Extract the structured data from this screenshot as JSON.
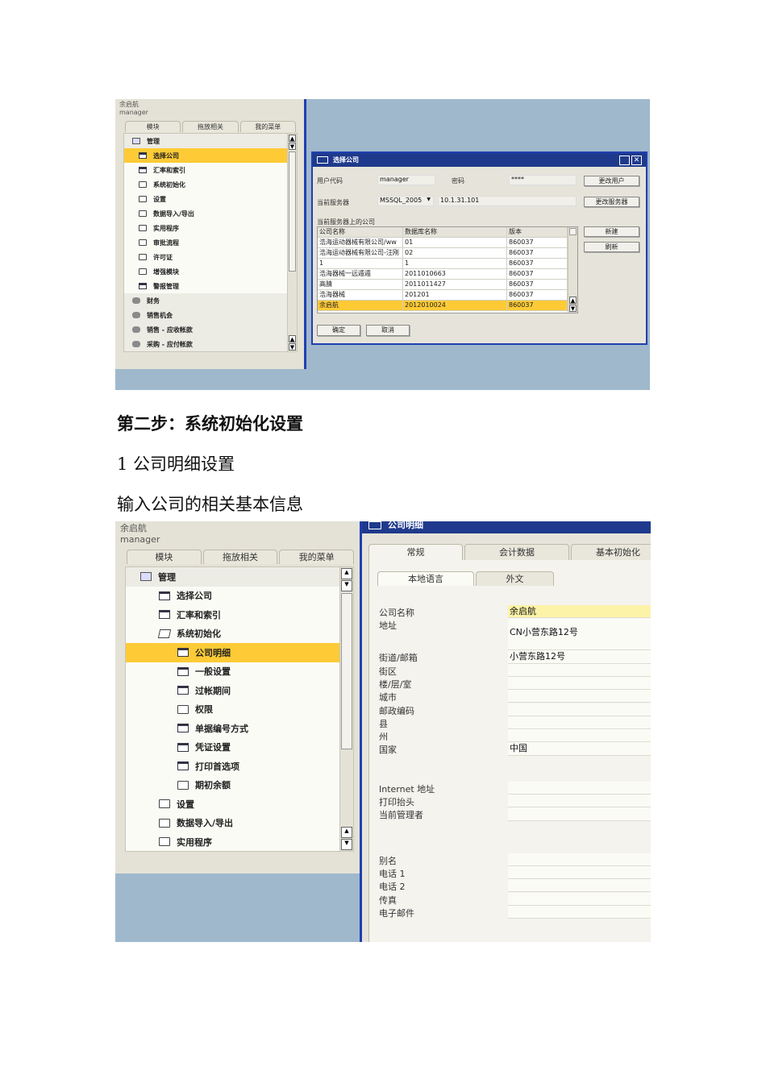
{
  "shot1": {
    "user": {
      "name": "余启航",
      "login": "manager"
    },
    "tabs": [
      "模块",
      "拖放相关",
      "我的菜单"
    ],
    "tree": [
      {
        "label": "管理",
        "icon": "module-icon",
        "kind": "head"
      },
      {
        "label": "选择公司",
        "icon": "form-icon",
        "kind": "sel"
      },
      {
        "label": "汇率和索引",
        "icon": "form-icon"
      },
      {
        "label": "系统初始化",
        "icon": "folder-icon"
      },
      {
        "label": "设置",
        "icon": "folder-icon"
      },
      {
        "label": "数据导入/导出",
        "icon": "folder-icon"
      },
      {
        "label": "实用程序",
        "icon": "folder-icon"
      },
      {
        "label": "审批流程",
        "icon": "folder-icon"
      },
      {
        "label": "许可证",
        "icon": "folder-icon"
      },
      {
        "label": "增强模块",
        "icon": "folder-icon"
      },
      {
        "label": "警报管理",
        "icon": "form-icon"
      },
      {
        "label": "财务",
        "icon": "finance-icon",
        "kind": "head"
      },
      {
        "label": "销售机会",
        "icon": "opportunity-icon",
        "kind": "head"
      },
      {
        "label": "销售 - 应收帐款",
        "icon": "sales-icon",
        "kind": "head"
      },
      {
        "label": "采购 - 应付帐款",
        "icon": "purchase-icon",
        "kind": "head"
      }
    ],
    "dialog": {
      "title": "选择公司",
      "user_code_label": "用户代码",
      "user_code": "manager",
      "password_label": "密码",
      "password": "****",
      "change_user": "更改用户",
      "server_label": "当前服务器",
      "server_type": "MSSQL_2005",
      "server_ip": "10.1.31.101",
      "change_server": "更改服务器",
      "list_label": "当前服务器上的公司",
      "new": "新建",
      "refresh": "刷新",
      "ok": "确定",
      "cancel": "取消",
      "columns": [
        "公司名称",
        "数据库名称",
        "版本"
      ],
      "rows": [
        [
          "浩海运动器械有限公司/ww",
          "01",
          "860037"
        ],
        [
          "浩海运动器械有限公司-汪刚",
          "02",
          "860037"
        ],
        [
          "1",
          "1",
          "860037"
        ],
        [
          "浩海器械一远遁遁",
          "2011010663",
          "860037"
        ],
        [
          "高腈",
          "2011011427",
          "860037"
        ],
        [
          "浩海器械",
          "201201",
          "860037"
        ],
        [
          "余启航",
          "2012010024",
          "860037"
        ]
      ]
    }
  },
  "doc": {
    "heading": "第二步：系统初始化设置",
    "sub": "1 公司明细设置",
    "para": "输入公司的相关基本信息"
  },
  "shot2": {
    "user": {
      "name": "余启航",
      "login": "manager"
    },
    "tabs": [
      "模块",
      "拖放相关",
      "我的菜单"
    ],
    "tree": [
      {
        "label": "管理",
        "icon": "module-icon",
        "kind": "head",
        "indent": 0
      },
      {
        "label": "选择公司",
        "icon": "form-icon",
        "indent": 1
      },
      {
        "label": "汇率和索引",
        "icon": "form-icon",
        "indent": 1
      },
      {
        "label": "系统初始化",
        "icon": "folder-open-icon",
        "indent": 1
      },
      {
        "label": "公司明细",
        "icon": "form-icon",
        "indent": 2,
        "kind": "sel"
      },
      {
        "label": "一般设置",
        "icon": "form-icon",
        "indent": 2
      },
      {
        "label": "过帐期间",
        "icon": "form-icon",
        "indent": 2
      },
      {
        "label": "权限",
        "icon": "folder-icon",
        "indent": 2
      },
      {
        "label": "单据编号方式",
        "icon": "form-icon",
        "indent": 2
      },
      {
        "label": "凭证设置",
        "icon": "form-icon",
        "indent": 2
      },
      {
        "label": "打印首选项",
        "icon": "form-icon",
        "indent": 2
      },
      {
        "label": "期初余额",
        "icon": "folder-icon",
        "indent": 2
      },
      {
        "label": "设置",
        "icon": "folder-icon",
        "indent": 1
      },
      {
        "label": "数据导入/导出",
        "icon": "folder-icon",
        "indent": 1
      },
      {
        "label": "实用程序",
        "icon": "folder-icon",
        "indent": 1
      }
    ],
    "form": {
      "title": "公司明细",
      "tabs": [
        "常规",
        "会计数据",
        "基本初始化"
      ],
      "subtabs": [
        "本地语言",
        "外文"
      ],
      "fields": [
        {
          "label": "公司名称",
          "value": "余启航",
          "y": 0
        },
        {
          "label": "地址",
          "value": "CN小营东路12号",
          "y": 1
        },
        {
          "label": "街道/邮箱",
          "value": "小营东路12号",
          "y": 2
        },
        {
          "label": "街区",
          "value": "",
          "y": 3
        },
        {
          "label": "楼/层/室",
          "value": "",
          "y": 4
        },
        {
          "label": "城市",
          "value": "",
          "y": 5
        },
        {
          "label": "邮政编码",
          "value": "",
          "y": 6
        },
        {
          "label": "县",
          "value": "",
          "y": 7
        },
        {
          "label": "州",
          "value": "",
          "y": 8
        },
        {
          "label": "国家",
          "value": "中国",
          "y": 9
        },
        {
          "label": "Internet 地址",
          "value": "",
          "y": 10
        },
        {
          "label": "打印抬头",
          "value": "",
          "y": 11
        },
        {
          "label": "当前管理者",
          "value": "",
          "y": 12
        },
        {
          "label": "别名",
          "value": "",
          "y": 13
        },
        {
          "label": "电话 1",
          "value": "",
          "y": 14
        },
        {
          "label": "电话 2",
          "value": "",
          "y": 15
        },
        {
          "label": "传真",
          "value": "",
          "y": 16
        },
        {
          "label": "电子邮件",
          "value": "",
          "y": 17
        }
      ]
    }
  }
}
